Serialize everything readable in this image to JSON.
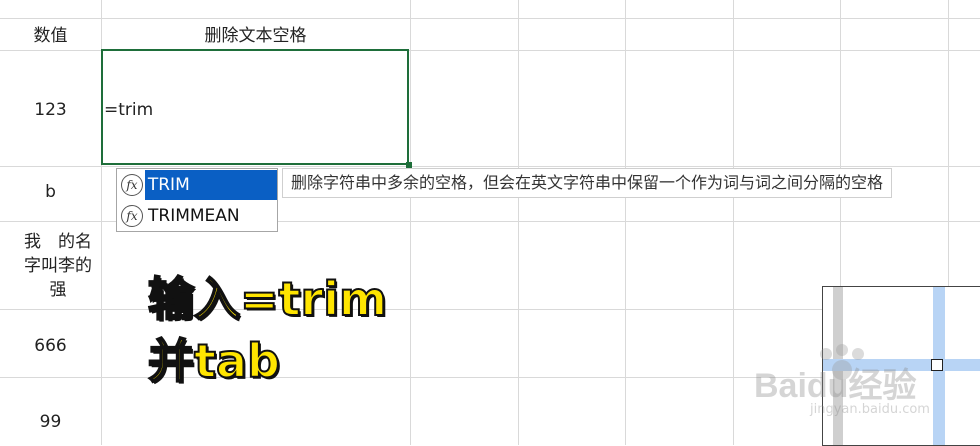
{
  "headers": {
    "col_a": "数值",
    "col_b": "删除文本空格"
  },
  "cells": {
    "row2_a": "123",
    "row3_a": "b",
    "row4_a": "我　的名字叫李的强",
    "row5_a": "666",
    "row6_a": "99"
  },
  "formula_input": "=trim",
  "autocomplete": {
    "items": [
      {
        "label": "TRIM",
        "selected": true
      },
      {
        "label": "TRIMMEAN",
        "selected": false
      }
    ],
    "tooltip": "删除字符串中多余的空格，但会在英文字符串中保留一个作为词与词之间分隔的空格"
  },
  "overlay": {
    "line1": "输入=trim",
    "line2": "并tab",
    "color": "#ffe500"
  },
  "watermark": {
    "brand": "Baidu经验",
    "url": "jingyan.baidu.com"
  },
  "colors": {
    "selection": "#0a5fc4",
    "active_border": "#1e6e3a",
    "grid": "#d9d9d9"
  }
}
